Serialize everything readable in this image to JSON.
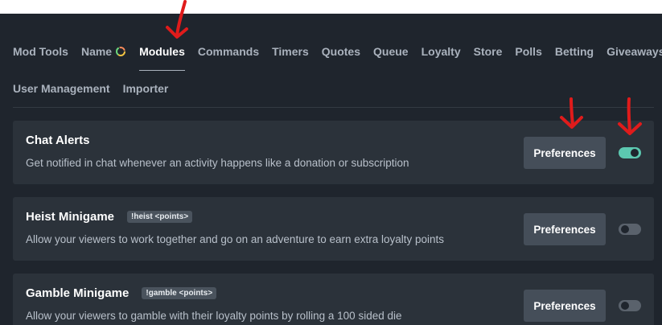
{
  "nav": {
    "row1": [
      "Mod Tools",
      "Name",
      "Modules",
      "Commands",
      "Timers",
      "Quotes",
      "Queue",
      "Loyalty",
      "Store",
      "Polls",
      "Betting",
      "Giveaways"
    ],
    "row2": [
      "User Management",
      "Importer"
    ],
    "active": "Modules"
  },
  "modules": [
    {
      "title": "Chat Alerts",
      "badge": "",
      "description": "Get notified in chat whenever an activity happens like a donation or subscription",
      "button": "Preferences",
      "enabled": true
    },
    {
      "title": "Heist Minigame",
      "badge": "!heist <points>",
      "description": "Allow your viewers to work together and go on an adventure to earn extra loyalty points",
      "button": "Preferences",
      "enabled": false
    },
    {
      "title": "Gamble Minigame",
      "badge": "!gamble <points>",
      "description": "Allow your viewers to gamble with their loyalty points by rolling a 100 sided die",
      "button": "Preferences",
      "enabled": false
    }
  ],
  "colors": {
    "background": "#1f252d",
    "card": "#2b323a",
    "button": "#454e59",
    "toggle_on": "#5cc8b0",
    "annotation_arrow": "#e01b1b"
  },
  "icons": {
    "name_status": "ring-icon",
    "annotation": "red-arrow-icon"
  }
}
